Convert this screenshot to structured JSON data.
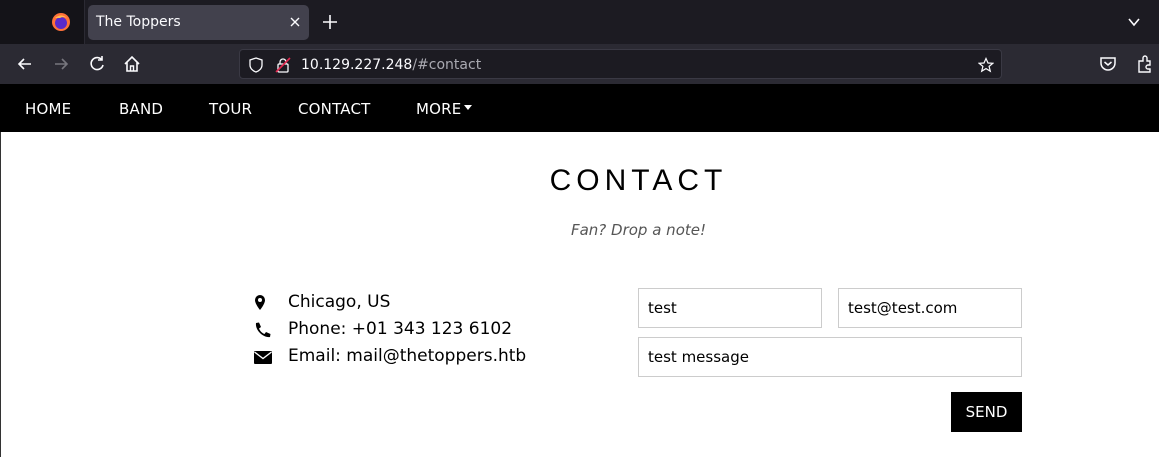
{
  "browser": {
    "tab_title": "The Toppers",
    "url_host": "10.129.227.248",
    "url_path": "/#contact"
  },
  "site_nav": {
    "items": [
      "HOME",
      "BAND",
      "TOUR",
      "CONTACT"
    ],
    "more_label": "MORE"
  },
  "contact": {
    "title": "CONTACT",
    "subtitle": "Fan? Drop a note!",
    "location": "Chicago, US",
    "phone": "Phone: +01 343 123 6102",
    "email": "Email: mail@thetoppers.htb"
  },
  "form": {
    "name_value": "test",
    "email_value": "test@test.com",
    "message_value": "test message",
    "send_label": "SEND"
  },
  "colors": {
    "chrome_dark": "#1c1b22",
    "chrome_toolbar": "#2b2a33",
    "site_nav_bg": "#000000",
    "button_bg": "#000000"
  }
}
